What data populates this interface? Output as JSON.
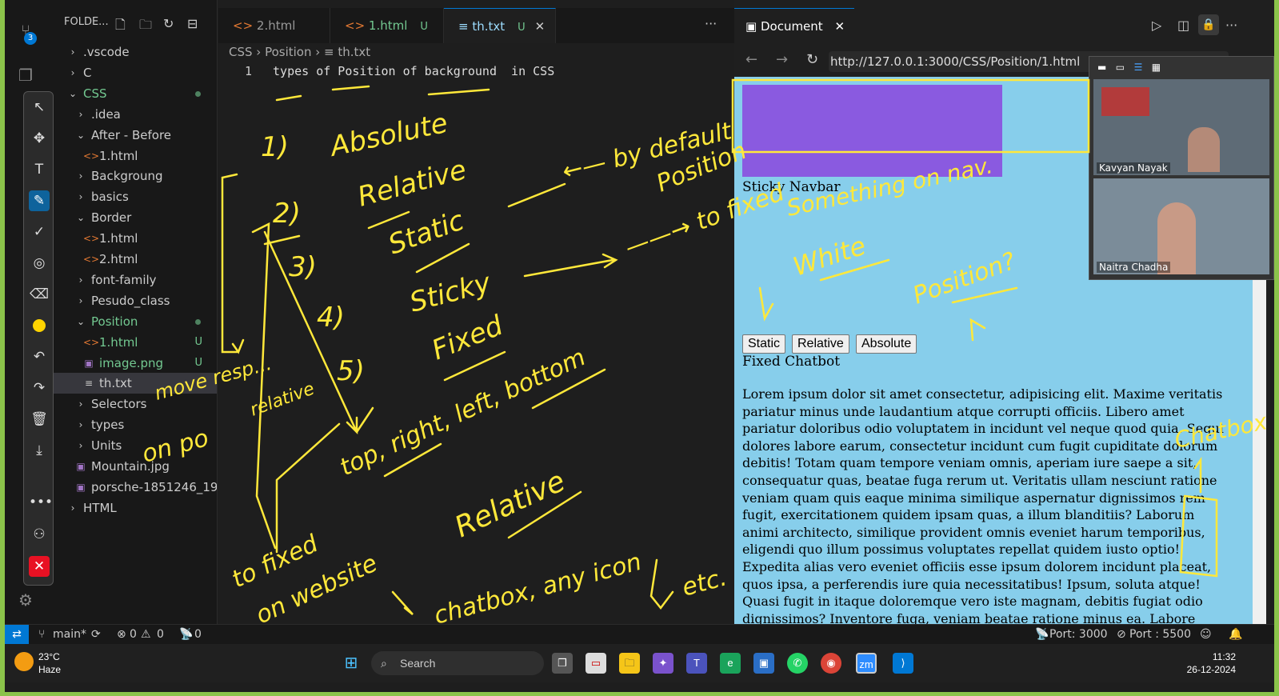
{
  "activity_badge": "3",
  "explorer": {
    "header": "FOLDE...",
    "items": [
      {
        "label": ".vscode",
        "kind": "folder",
        "open": false,
        "depth": 0
      },
      {
        "label": "C",
        "kind": "folder",
        "open": false,
        "depth": 0
      },
      {
        "label": "CSS",
        "kind": "folder",
        "open": true,
        "depth": 0,
        "git": "dot"
      },
      {
        "label": ".idea",
        "kind": "folder",
        "open": false,
        "depth": 1
      },
      {
        "label": "After - Before",
        "kind": "folder",
        "open": true,
        "depth": 1
      },
      {
        "label": "1.html",
        "kind": "html",
        "depth": 2
      },
      {
        "label": "Backgroung",
        "kind": "folder",
        "open": false,
        "depth": 1
      },
      {
        "label": "basics",
        "kind": "folder",
        "open": false,
        "depth": 1
      },
      {
        "label": "Border",
        "kind": "folder",
        "open": true,
        "depth": 1
      },
      {
        "label": "1.html",
        "kind": "html",
        "depth": 2
      },
      {
        "label": "2.html",
        "kind": "html",
        "depth": 2
      },
      {
        "label": "font-family",
        "kind": "folder",
        "open": false,
        "depth": 1
      },
      {
        "label": "Pesudo_class",
        "kind": "folder",
        "open": false,
        "depth": 1
      },
      {
        "label": "Position",
        "kind": "folder",
        "open": true,
        "depth": 1,
        "git": "dot"
      },
      {
        "label": "1.html",
        "kind": "html",
        "depth": 2,
        "git": "U"
      },
      {
        "label": "image.png",
        "kind": "image",
        "depth": 2,
        "git": "U"
      },
      {
        "label": "th.txt",
        "kind": "text",
        "depth": 2,
        "selected": true
      },
      {
        "label": "Selectors",
        "kind": "folder",
        "open": false,
        "depth": 1
      },
      {
        "label": "types",
        "kind": "folder",
        "open": false,
        "depth": 1
      },
      {
        "label": "Units",
        "kind": "folder",
        "open": false,
        "depth": 1
      },
      {
        "label": "Mountain.jpg",
        "kind": "image",
        "depth": 1
      },
      {
        "label": "porsche-1851246_192...",
        "kind": "image",
        "depth": 1
      },
      {
        "label": "HTML",
        "kind": "folder",
        "open": false,
        "depth": 0
      }
    ]
  },
  "tabs": [
    {
      "label": "2.html",
      "icon": "<>",
      "status": ""
    },
    {
      "label": "1.html",
      "icon": "<>",
      "status": "U"
    },
    {
      "label": "th.txt",
      "icon": "≡",
      "status": "U",
      "active": true
    }
  ],
  "breadcrumb": {
    "p1": "CSS",
    "p2": "Position",
    "p3": "th.txt"
  },
  "editor": {
    "line_number": "1",
    "line_text": "types of Position of background  in CSS"
  },
  "preview": {
    "tab_title": "Document",
    "url": "http://127.0.0.1:3000/CSS/Position/1.html",
    "sticky_label": "Sticky Navbar",
    "buttons": [
      "Static",
      "Relative",
      "Absolute"
    ],
    "fixed_label": "Fixed Chatbot",
    "lorem": "Lorem ipsum dolor sit amet consectetur, adipisicing elit. Maxime veritatis pariatur minus unde laudantium atque corrupti officiis. Libero amet pariatur doloribus odio voluptatem in incidunt vel neque quod quia. Sequi dolores labore earum, consectetur incidunt cum fugit cupiditate dolorum debitis! Totam quam tempore veniam omnis, aperiam iure saepe a sit, consequatur quas, beatae fuga rerum ut. Veritatis ullam nesciunt ratione veniam quam quis eaque minima similique aspernatur dignissimos rem fugit, exercitationem quidem ipsam quas, a illum blanditiis? Laborum animi architecto, similique provident omnis eveniet harum temporibus, eligendi quo illum possimus voluptates repellat quidem iusto optio! Expedita alias vero eveniet officiis esse ipsum dolorem incidunt placeat, quos ipsa, a perferendis iure quia necessitatibus! Ipsum, soluta atque! Quasi fugit in itaque doloremque vero iste magnam, debitis fugiat odio dignissimos? Inventore fuga, veniam beatae ratione minus ea. Labore corrupti eius ullam cupiditate, officia provident repellendus hic fugit aliquam culpa iusto placeat"
  },
  "zoom": {
    "participant1": "Kavyan Nayak",
    "participant2": "Naitra Chadha"
  },
  "statusbar": {
    "branch": "main*",
    "errors": "0",
    "warnings": "0",
    "ports": "0",
    "port_live": "Port: 3000",
    "port_other": "Port : 5500"
  },
  "taskbar": {
    "temp": "23°C",
    "weather": "Haze",
    "search": "Search",
    "time": "11:32",
    "date": "26-12-2024",
    "zoom_app": "zm"
  },
  "ink_notes": {
    "n1": "1)",
    "n2": "Absolute",
    "n3": "2)",
    "n4": "Relative",
    "n5": "3)",
    "n6": "Static",
    "n7": "←— by default",
    "n8": "Position",
    "n9": "4)",
    "n10": "Sticky",
    "n11": "——→ to fixed",
    "n12": "5)",
    "n13": "Fixed",
    "n14": "top, right, left, bottom",
    "n15": "move resp...",
    "n16": "relative",
    "n17": "on po",
    "n18": "to fixed",
    "n19": "on website",
    "n20": "Relative",
    "n21": "chatbox, any icon",
    "n22": "etc.",
    "n23": "Something on nav.",
    "n24": "White",
    "n25": "Position?",
    "n26": "Chatbox"
  }
}
